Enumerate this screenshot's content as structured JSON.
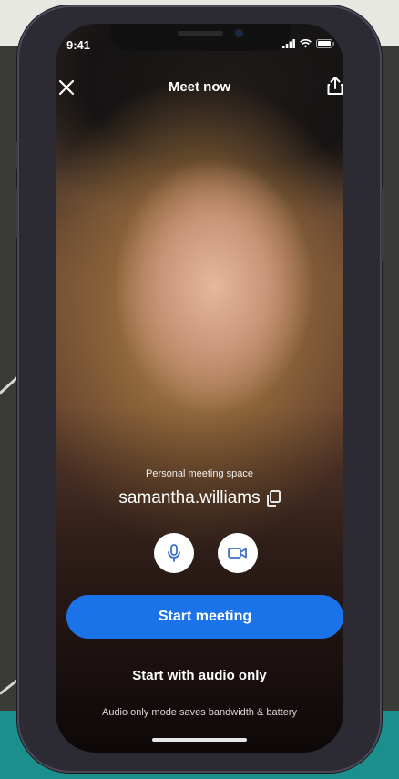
{
  "status_bar": {
    "time": "9:41"
  },
  "header": {
    "title": "Meet now"
  },
  "meeting": {
    "space_label": "Personal meeting space",
    "username": "samantha.williams"
  },
  "actions": {
    "start_meeting": "Start meeting",
    "audio_only": "Start with audio only",
    "audio_only_note": "Audio only mode saves bandwidth & battery"
  },
  "icons": [
    "close-icon",
    "share-icon",
    "copy-icon",
    "microphone-icon",
    "video-camera-icon",
    "signal-icon",
    "wifi-icon",
    "battery-icon"
  ],
  "colors": {
    "accent": "#1a73e8",
    "teal": "#1a8f8c",
    "backdrop": "#3a3a36"
  }
}
